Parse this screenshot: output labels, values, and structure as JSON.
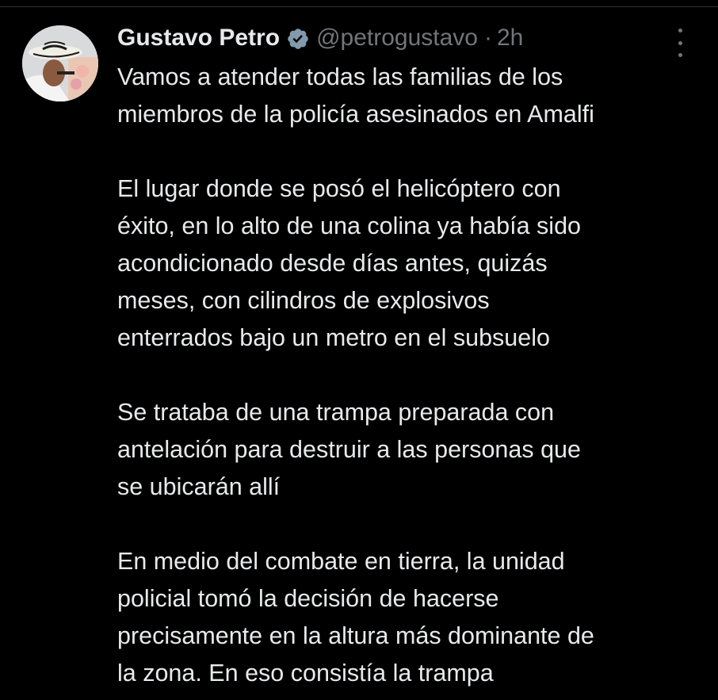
{
  "tweet": {
    "author": {
      "display_name": "Gustavo Petro",
      "handle": "@petrogustavo",
      "verified_icon": "verified-badge-icon",
      "avatar_icon": "user-avatar"
    },
    "separator": "·",
    "time": "2h",
    "more_icon": "more-options-icon",
    "paragraphs": [
      "Vamos a atender todas las familias de los\nmiembros de la policía asesinados en Amalfi",
      "El lugar donde se posó el helicóptero con\néxito, en lo alto de una colina ya había sido\nacondicionado desde días antes, quizás\nmeses, con cilindros de explosivos\nenterrados bajo un metro en el subsuelo",
      "Se trataba de una trampa preparada con\nantelación para destruir a las personas que\nse ubicarán allí",
      "En medio del combate en tierra, la unidad\npolicial tomó la decisión de hacerse\nprecisamente en la altura más dominante de\nla zona. En eso consistía la trampa"
    ]
  },
  "colors": {
    "background": "#000000",
    "text_primary": "#e7e9ea",
    "text_secondary": "#71767b",
    "verified_badge": "#829aab",
    "divider": "#2f3336"
  }
}
